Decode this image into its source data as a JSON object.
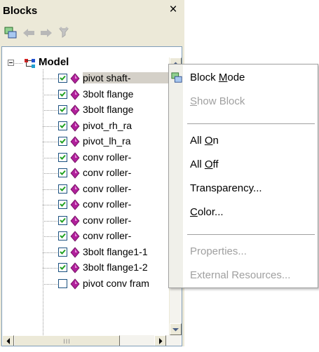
{
  "panel": {
    "title": "Blocks",
    "close_glyph": "×",
    "toolbar": [
      {
        "name": "block-mode-icon",
        "enabled": true
      },
      {
        "name": "back-arrow-icon",
        "enabled": false
      },
      {
        "name": "forward-arrow-icon",
        "enabled": false
      },
      {
        "name": "filter-icon",
        "enabled": false
      }
    ]
  },
  "tree": {
    "root_label": "Model",
    "items": [
      {
        "label": "pivot shaft-",
        "checked": true,
        "selected": true
      },
      {
        "label": "3bolt flange",
        "checked": true
      },
      {
        "label": "3bolt flange",
        "checked": true
      },
      {
        "label": "pivot_rh_ra",
        "checked": true
      },
      {
        "label": "pivot_lh_ra",
        "checked": true
      },
      {
        "label": "conv roller-",
        "checked": true
      },
      {
        "label": "conv roller-",
        "checked": true
      },
      {
        "label": "conv roller-",
        "checked": true
      },
      {
        "label": "conv roller-",
        "checked": true
      },
      {
        "label": "conv roller-",
        "checked": true
      },
      {
        "label": "conv roller-",
        "checked": true
      },
      {
        "label": "3bolt flange1-1",
        "checked": true
      },
      {
        "label": "3bolt flange1-2",
        "checked": true
      },
      {
        "label": "pivot conv fram",
        "checked": false
      }
    ],
    "hscroll_thumb_glyph": "III"
  },
  "context_menu": {
    "items": [
      {
        "label": "Block Mode",
        "mnemonic": "M",
        "enabled": true,
        "icon": "block-mode-icon"
      },
      {
        "label": "Show Block",
        "mnemonic": "S",
        "enabled": false
      },
      {
        "separator": true
      },
      {
        "label": "All On",
        "mnemonic": "O",
        "enabled": true
      },
      {
        "label": "All Off",
        "mnemonic": "O",
        "enabled": true
      },
      {
        "label": "Transparency...",
        "enabled": true
      },
      {
        "label": "Color...",
        "mnemonic": "C",
        "enabled": true
      },
      {
        "separator": true
      },
      {
        "label": "Properties...",
        "enabled": false
      },
      {
        "label": "External Resources...",
        "enabled": false
      }
    ]
  },
  "colors": {
    "panel_bg": "#ece9d8",
    "diamond": "#b0209a",
    "checkbox_border": "#1c5180",
    "checkmark": "#21a121",
    "disabled_text": "#a0a0a0"
  }
}
